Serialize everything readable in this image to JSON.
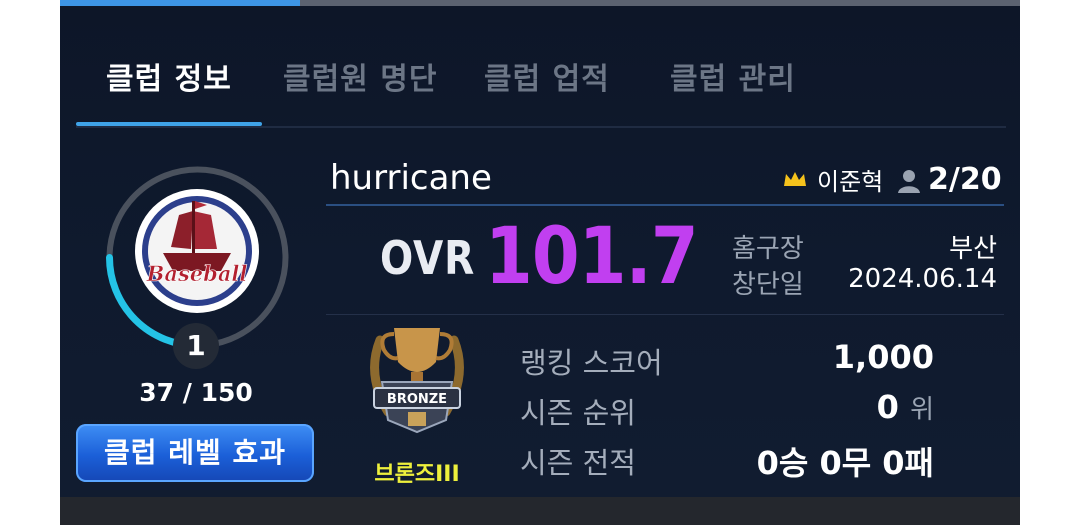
{
  "top_progress": {
    "fraction": 0.25
  },
  "tabs": [
    {
      "label": "클럽 정보",
      "active": true
    },
    {
      "label": "클럽원 명단",
      "active": false
    },
    {
      "label": "클럽 업적",
      "active": false
    },
    {
      "label": "클럽 관리",
      "active": false
    }
  ],
  "club": {
    "name": "hurricane",
    "leader": "이준혁",
    "members": "2/20",
    "ovr_label": "OVR",
    "ovr_value": "101.7",
    "emblem_text": "Baseball",
    "home_label": "홈구장",
    "home_value": "부산",
    "founded_label": "창단일",
    "founded_value": "2024.06.14"
  },
  "level": {
    "value": "1",
    "exp": "37 / 150",
    "progress": 0.25,
    "button_label": "클럽 레벨 효과"
  },
  "ranking": {
    "tier": "브론즈III",
    "badge_text": "BRONZE",
    "score_label": "랭킹 스코어",
    "score_value": "1,000",
    "rank_label": "시즌 순위",
    "rank_value": "0",
    "rank_unit": "위",
    "record_label": "시즌 전적",
    "record_value": "0승 0무 0패"
  },
  "colors": {
    "accent": "#3fa3e8",
    "ovr": "#c13ff0",
    "tier": "#eef03c",
    "ring": "#24c3e6"
  },
  "icons": [
    "crown-icon",
    "person-icon",
    "ship-emblem-icon",
    "trophy-icon"
  ]
}
